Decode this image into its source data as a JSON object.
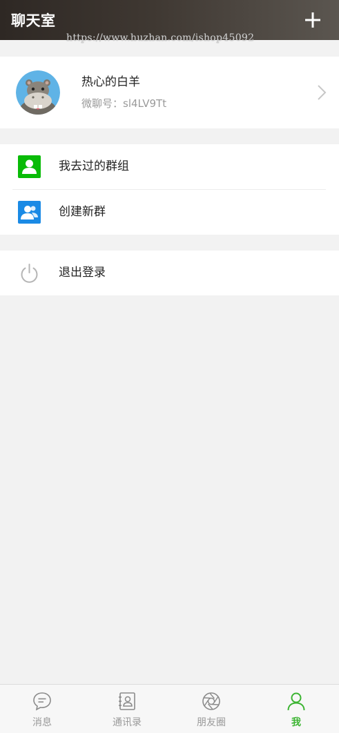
{
  "header": {
    "title": "聊天室",
    "watermark": "https://www.huzhan.com/ishop45092"
  },
  "profile": {
    "nickname": "热心的白羊",
    "wechat_id": "微聊号：sl4LV9Tt"
  },
  "menu": {
    "groups": [
      {
        "label": "我去过的群组",
        "icon": "group-visited-icon",
        "color": "#09bb07"
      },
      {
        "label": "创建新群",
        "icon": "create-group-icon",
        "color": "#1a8ae5"
      }
    ],
    "logout": {
      "label": "退出登录",
      "icon": "power-icon"
    }
  },
  "tabbar": {
    "active_color": "#3bb431",
    "items": [
      {
        "label": "消息",
        "icon": "chat-bubble-icon",
        "active": false
      },
      {
        "label": "通讯录",
        "icon": "contacts-book-icon",
        "active": false
      },
      {
        "label": "朋友圈",
        "icon": "aperture-icon",
        "active": false
      },
      {
        "label": "我",
        "icon": "person-icon",
        "active": true
      }
    ]
  }
}
